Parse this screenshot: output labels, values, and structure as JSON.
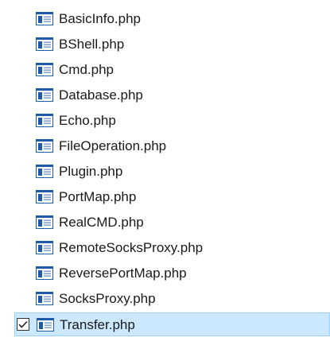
{
  "files": [
    {
      "name": "BasicInfo.php",
      "icon": "php-file-icon",
      "selected": false
    },
    {
      "name": "BShell.php",
      "icon": "php-file-icon",
      "selected": false
    },
    {
      "name": "Cmd.php",
      "icon": "php-file-icon",
      "selected": false
    },
    {
      "name": "Database.php",
      "icon": "php-file-icon",
      "selected": false
    },
    {
      "name": "Echo.php",
      "icon": "php-file-icon",
      "selected": false
    },
    {
      "name": "FileOperation.php",
      "icon": "php-file-icon",
      "selected": false
    },
    {
      "name": "Plugin.php",
      "icon": "php-file-icon",
      "selected": false
    },
    {
      "name": "PortMap.php",
      "icon": "php-file-icon",
      "selected": false
    },
    {
      "name": "RealCMD.php",
      "icon": "php-file-icon",
      "selected": false
    },
    {
      "name": "RemoteSocksProxy.php",
      "icon": "php-file-icon",
      "selected": false
    },
    {
      "name": "ReversePortMap.php",
      "icon": "php-file-icon",
      "selected": false
    },
    {
      "name": "SocksProxy.php",
      "icon": "php-file-icon",
      "selected": false
    },
    {
      "name": "Transfer.php",
      "icon": "php-file-icon",
      "selected": true
    }
  ],
  "colors": {
    "selection_background": "#cce8ff",
    "selection_border": "#99d1ff",
    "icon_blue": "#1e5aa8"
  }
}
